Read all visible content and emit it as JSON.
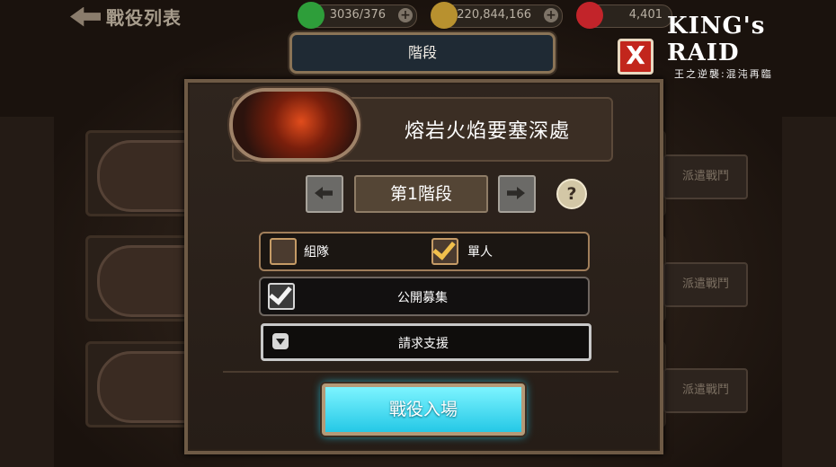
{
  "header": {
    "back_label": "戰役列表",
    "stamina": "3036/376",
    "gold": "220,844,166",
    "gems": "4,401"
  },
  "logo": {
    "main": "KING's RAID",
    "sub": "王之逆襲:混沌再臨"
  },
  "background_list": {
    "dispatch_labels": [
      "派遣戰鬥",
      "派遣戰鬥",
      "派遣戰鬥"
    ]
  },
  "dialog": {
    "title": "階段",
    "dungeon_name": "熔岩火焰要塞深處",
    "stage_label": "第1階段",
    "help": "?",
    "close": "X",
    "mode_party": "組隊",
    "mode_party_checked": false,
    "mode_solo": "單人",
    "mode_solo_checked": true,
    "public_recruit": "公開募集",
    "public_recruit_checked": true,
    "request_support": "請求支援",
    "enter_button": "戰役入場"
  },
  "colors": {
    "enter_button": "#3fd6ef",
    "close_button": "#c2261c",
    "check_gold": "#f1c04c"
  }
}
